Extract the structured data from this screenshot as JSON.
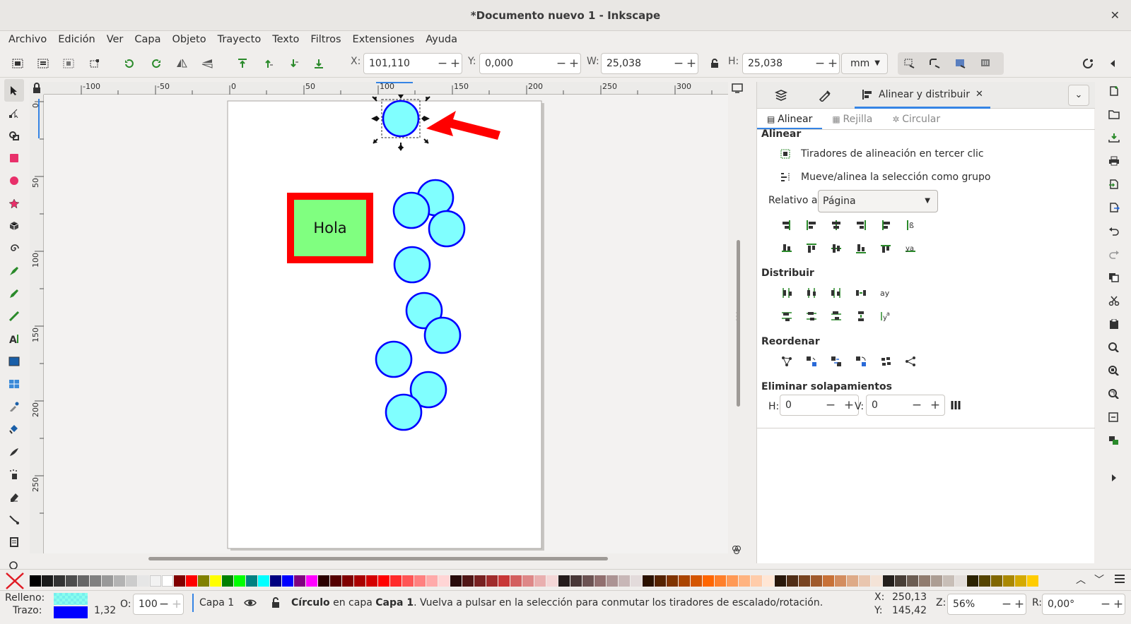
{
  "window": {
    "title": "*Documento nuevo 1 - Inkscape",
    "close": "✕"
  },
  "menu": [
    "Archivo",
    "Edición",
    "Ver",
    "Capa",
    "Objeto",
    "Trayecto",
    "Texto",
    "Filtros",
    "Extensiones",
    "Ayuda"
  ],
  "toolbar": {
    "x_label": "X:",
    "x_value": "101,110",
    "y_label": "Y:",
    "y_value": "0,000",
    "w_label": "W:",
    "w_value": "25,038",
    "h_label": "H:",
    "h_value": "25,038",
    "unit": "mm"
  },
  "ruler": {
    "h_ticks": [
      "-100",
      "-50",
      "0",
      "50",
      "100",
      "150",
      "200",
      "250",
      "300"
    ],
    "v_ticks": [
      "0",
      "50",
      "100",
      "150",
      "200",
      "250"
    ]
  },
  "canvas": {
    "text_box_label": "Hola"
  },
  "dock": {
    "tab_title": "Alinear y distribuir",
    "subtabs": [
      "Alinear",
      "Rejilla",
      "Circular"
    ],
    "align_heading": "Alinear",
    "option_third_click": "Tiradores de alineación en tercer clic",
    "option_move_group": "Mueve/alinea la selección como grupo",
    "relative_label": "Relativo a:",
    "relative_value": "Página",
    "distribute_heading": "Distribuir",
    "reorder_heading": "Reordenar",
    "overlap_heading": "Eliminar solapamientos",
    "overlap_h_label": "H:",
    "overlap_h_value": "0",
    "overlap_v_label": "V:",
    "overlap_v_value": "0"
  },
  "status": {
    "fill_label": "Relleno:",
    "stroke_label": "Trazo:",
    "stroke_width": "1,32",
    "opacity_label": "O:",
    "opacity_value": "100",
    "layer": "Capa 1",
    "msg_object": "Círculo",
    "msg_in_layer": " en capa ",
    "msg_layer": "Capa 1",
    "msg_rest": ". Vuelva a pulsar en la selección para conmutar los tiradores de escalado/rotación.",
    "cursor_x_label": "X:",
    "cursor_x": "250,13",
    "cursor_y_label": "Y:",
    "cursor_y": "145,42",
    "zoom_label": "Z:",
    "zoom": "56%",
    "rotation_label": "R:",
    "rotation": "0,00°"
  },
  "colors": {
    "fill": "#80ffff",
    "stroke": "#0000ff",
    "accent": "#3584e4",
    "rect_fill": "#80ff80",
    "rect_stroke": "#ff0000",
    "arrow": "#ff0000"
  }
}
